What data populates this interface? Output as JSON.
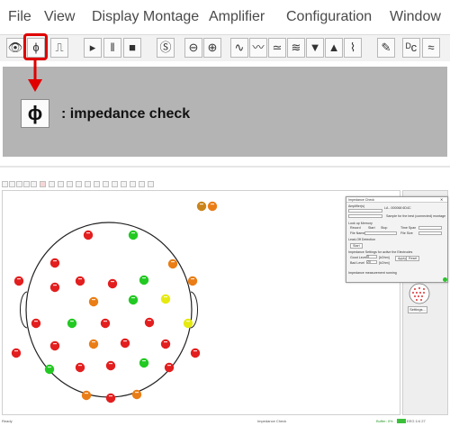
{
  "menubar": {
    "items": [
      "File",
      "View",
      "Display Montage",
      "Amplifier",
      "Configuration",
      "Window"
    ]
  },
  "toolbar": {
    "buttons": [
      {
        "name": "eye-icon",
        "glyph": "👁"
      },
      {
        "name": "impedance-icon",
        "glyph": "ϕ"
      },
      {
        "name": "pulse-icon",
        "glyph": "⎍"
      },
      {
        "name": "play-icon",
        "glyph": "▸"
      },
      {
        "name": "pause-icon",
        "glyph": "ǁ"
      },
      {
        "name": "stop-icon",
        "glyph": "■"
      },
      {
        "name": "s-icon",
        "glyph": "Ⓢ"
      },
      {
        "name": "zoom-out-icon",
        "glyph": "⊖"
      },
      {
        "name": "zoom-in-icon",
        "glyph": "⊕"
      },
      {
        "name": "wave-icon",
        "glyph": "∿"
      },
      {
        "name": "wave2-icon",
        "glyph": "〰"
      },
      {
        "name": "wave3-icon",
        "glyph": "≃"
      },
      {
        "name": "filter-icon",
        "glyph": "≋"
      },
      {
        "name": "triangle-down-icon",
        "glyph": "▼"
      },
      {
        "name": "triangle-up-icon",
        "glyph": "▲"
      },
      {
        "name": "marker-icon",
        "glyph": "⌇"
      },
      {
        "name": "pen-icon",
        "glyph": "✎"
      },
      {
        "name": "dc-icon",
        "glyph": "ᴰc"
      },
      {
        "name": "notch-icon",
        "glyph": "≈"
      }
    ]
  },
  "annotation": {
    "icon_glyph": "ϕ",
    "caption": ": impedance check",
    "highlight_color": "#e00000"
  },
  "screenshot": {
    "status_left": "Ready",
    "status_mid": "Impedance Check",
    "status_right1": "Buffer: 0%",
    "status_right2": "EEG 1/4 27",
    "settings_label": "Settings...",
    "dialog": {
      "title": "Impedance Check",
      "amplifier_label": "Amplifier(s)",
      "amplifier_value": "LA - 000068 6D4C",
      "checkbox_label": "Sample for the best (connected) montage",
      "lookup_label": "Look up Memory",
      "record_label": "Record",
      "start_label": "Start",
      "stop_label": "Stop",
      "time_span_label": "Time Span",
      "file_name_label": "File Name",
      "file_size_label": "File Size",
      "lead_off_label": "Lead-Off Detection",
      "start_btn": "Start",
      "settings_title": "Impedance Settings for active the Electrodes",
      "good_label": "Good Level",
      "good_value": "5",
      "bad_label": "Bad Level",
      "bad_value": "20",
      "unit": "[kOhm]",
      "apply_label": "Apply",
      "reset_label": "Reset",
      "status_text": "Impedance measurement running"
    }
  },
  "colors": {
    "red": "#e31e1e",
    "green": "#22c922",
    "orange": "#ea7d16",
    "yellow": "#e6ea10",
    "darkorange": "#c9841a"
  }
}
